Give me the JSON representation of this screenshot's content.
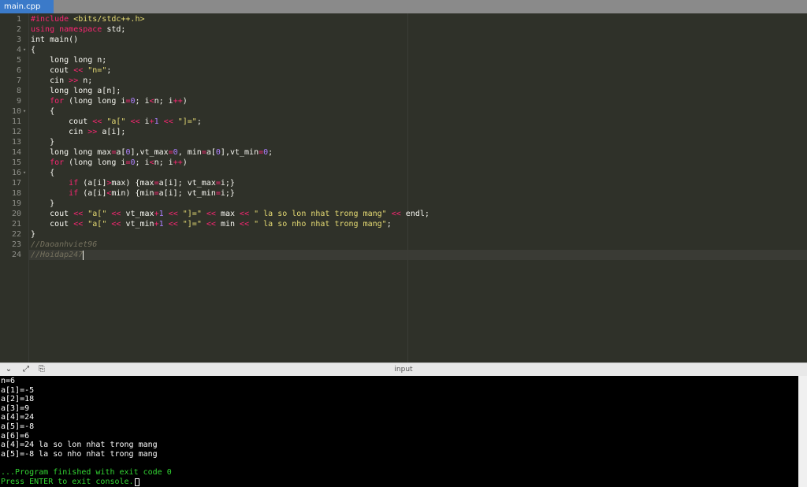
{
  "tab": {
    "label": "main.cpp"
  },
  "editor": {
    "line_numbers": [
      "1",
      "2",
      "3",
      "4",
      "5",
      "6",
      "7",
      "8",
      "9",
      "10",
      "11",
      "12",
      "13",
      "14",
      "15",
      "16",
      "17",
      "18",
      "19",
      "20",
      "21",
      "22",
      "23",
      "24"
    ],
    "fold_markers": {
      "4": "▾",
      "10": "▾",
      "16": "▾"
    },
    "lines": [
      [
        {
          "t": "pp",
          "v": "#include "
        },
        {
          "t": "inc",
          "v": "<bits/stdc++.h>"
        }
      ],
      [
        {
          "t": "kw",
          "v": "using"
        },
        {
          "t": "plain",
          "v": " "
        },
        {
          "t": "kw",
          "v": "namespace"
        },
        {
          "t": "plain",
          "v": " std;"
        }
      ],
      [
        {
          "t": "plain",
          "v": "int main()"
        }
      ],
      [
        {
          "t": "plain",
          "v": "{"
        }
      ],
      [
        {
          "t": "plain",
          "v": "    long long n;"
        }
      ],
      [
        {
          "t": "plain",
          "v": "    cout "
        },
        {
          "t": "kw",
          "v": "<<"
        },
        {
          "t": "plain",
          "v": " "
        },
        {
          "t": "str",
          "v": "\"n=\""
        },
        {
          "t": "plain",
          "v": ";"
        }
      ],
      [
        {
          "t": "plain",
          "v": "    cin "
        },
        {
          "t": "kw",
          "v": ">>"
        },
        {
          "t": "plain",
          "v": " n;"
        }
      ],
      [
        {
          "t": "plain",
          "v": "    long long a[n];"
        }
      ],
      [
        {
          "t": "plain",
          "v": "    "
        },
        {
          "t": "kw",
          "v": "for"
        },
        {
          "t": "plain",
          "v": " (long long i"
        },
        {
          "t": "kw",
          "v": "="
        },
        {
          "t": "num",
          "v": "0"
        },
        {
          "t": "plain",
          "v": "; i"
        },
        {
          "t": "kw",
          "v": "<"
        },
        {
          "t": "plain",
          "v": "n; i"
        },
        {
          "t": "kw",
          "v": "++"
        },
        {
          "t": "plain",
          "v": ")"
        }
      ],
      [
        {
          "t": "plain",
          "v": "    {"
        }
      ],
      [
        {
          "t": "plain",
          "v": "        cout "
        },
        {
          "t": "kw",
          "v": "<<"
        },
        {
          "t": "plain",
          "v": " "
        },
        {
          "t": "str",
          "v": "\"a[\""
        },
        {
          "t": "plain",
          "v": " "
        },
        {
          "t": "kw",
          "v": "<<"
        },
        {
          "t": "plain",
          "v": " i"
        },
        {
          "t": "kw",
          "v": "+"
        },
        {
          "t": "num",
          "v": "1"
        },
        {
          "t": "plain",
          "v": " "
        },
        {
          "t": "kw",
          "v": "<<"
        },
        {
          "t": "plain",
          "v": " "
        },
        {
          "t": "str",
          "v": "\"]=\""
        },
        {
          "t": "plain",
          "v": ";"
        }
      ],
      [
        {
          "t": "plain",
          "v": "        cin "
        },
        {
          "t": "kw",
          "v": ">>"
        },
        {
          "t": "plain",
          "v": " a[i];"
        }
      ],
      [
        {
          "t": "plain",
          "v": "    }"
        }
      ],
      [
        {
          "t": "plain",
          "v": "    long long max"
        },
        {
          "t": "kw",
          "v": "="
        },
        {
          "t": "plain",
          "v": "a["
        },
        {
          "t": "num",
          "v": "0"
        },
        {
          "t": "plain",
          "v": "],vt_max"
        },
        {
          "t": "kw",
          "v": "="
        },
        {
          "t": "num",
          "v": "0"
        },
        {
          "t": "plain",
          "v": ", min"
        },
        {
          "t": "kw",
          "v": "="
        },
        {
          "t": "plain",
          "v": "a["
        },
        {
          "t": "num",
          "v": "0"
        },
        {
          "t": "plain",
          "v": "],vt_min"
        },
        {
          "t": "kw",
          "v": "="
        },
        {
          "t": "num",
          "v": "0"
        },
        {
          "t": "plain",
          "v": ";"
        }
      ],
      [
        {
          "t": "plain",
          "v": "    "
        },
        {
          "t": "kw",
          "v": "for"
        },
        {
          "t": "plain",
          "v": " (long long i"
        },
        {
          "t": "kw",
          "v": "="
        },
        {
          "t": "num",
          "v": "0"
        },
        {
          "t": "plain",
          "v": "; i"
        },
        {
          "t": "kw",
          "v": "<"
        },
        {
          "t": "plain",
          "v": "n; i"
        },
        {
          "t": "kw",
          "v": "++"
        },
        {
          "t": "plain",
          "v": ")"
        }
      ],
      [
        {
          "t": "plain",
          "v": "    {"
        }
      ],
      [
        {
          "t": "plain",
          "v": "        "
        },
        {
          "t": "kw",
          "v": "if"
        },
        {
          "t": "plain",
          "v": " (a[i]"
        },
        {
          "t": "kw",
          "v": ">"
        },
        {
          "t": "plain",
          "v": "max) {max"
        },
        {
          "t": "kw",
          "v": "="
        },
        {
          "t": "plain",
          "v": "a[i]; vt_max"
        },
        {
          "t": "kw",
          "v": "="
        },
        {
          "t": "plain",
          "v": "i;}"
        }
      ],
      [
        {
          "t": "plain",
          "v": "        "
        },
        {
          "t": "kw",
          "v": "if"
        },
        {
          "t": "plain",
          "v": " (a[i]"
        },
        {
          "t": "kw",
          "v": "<"
        },
        {
          "t": "plain",
          "v": "min) {min"
        },
        {
          "t": "kw",
          "v": "="
        },
        {
          "t": "plain",
          "v": "a[i]; vt_min"
        },
        {
          "t": "kw",
          "v": "="
        },
        {
          "t": "plain",
          "v": "i;}"
        }
      ],
      [
        {
          "t": "plain",
          "v": "    }"
        }
      ],
      [
        {
          "t": "plain",
          "v": "    cout "
        },
        {
          "t": "kw",
          "v": "<<"
        },
        {
          "t": "plain",
          "v": " "
        },
        {
          "t": "str",
          "v": "\"a[\""
        },
        {
          "t": "plain",
          "v": " "
        },
        {
          "t": "kw",
          "v": "<<"
        },
        {
          "t": "plain",
          "v": " vt_max"
        },
        {
          "t": "kw",
          "v": "+"
        },
        {
          "t": "num",
          "v": "1"
        },
        {
          "t": "plain",
          "v": " "
        },
        {
          "t": "kw",
          "v": "<<"
        },
        {
          "t": "plain",
          "v": " "
        },
        {
          "t": "str",
          "v": "\"]=\""
        },
        {
          "t": "plain",
          "v": " "
        },
        {
          "t": "kw",
          "v": "<<"
        },
        {
          "t": "plain",
          "v": " max "
        },
        {
          "t": "kw",
          "v": "<<"
        },
        {
          "t": "plain",
          "v": " "
        },
        {
          "t": "str",
          "v": "\" la so lon nhat trong mang\""
        },
        {
          "t": "plain",
          "v": " "
        },
        {
          "t": "kw",
          "v": "<<"
        },
        {
          "t": "plain",
          "v": " endl;"
        }
      ],
      [
        {
          "t": "plain",
          "v": "    cout "
        },
        {
          "t": "kw",
          "v": "<<"
        },
        {
          "t": "plain",
          "v": " "
        },
        {
          "t": "str",
          "v": "\"a[\""
        },
        {
          "t": "plain",
          "v": " "
        },
        {
          "t": "kw",
          "v": "<<"
        },
        {
          "t": "plain",
          "v": " vt_min"
        },
        {
          "t": "kw",
          "v": "+"
        },
        {
          "t": "num",
          "v": "1"
        },
        {
          "t": "plain",
          "v": " "
        },
        {
          "t": "kw",
          "v": "<<"
        },
        {
          "t": "plain",
          "v": " "
        },
        {
          "t": "str",
          "v": "\"]=\""
        },
        {
          "t": "plain",
          "v": " "
        },
        {
          "t": "kw",
          "v": "<<"
        },
        {
          "t": "plain",
          "v": " min "
        },
        {
          "t": "kw",
          "v": "<<"
        },
        {
          "t": "plain",
          "v": " "
        },
        {
          "t": "str",
          "v": "\" la so nho nhat trong mang\""
        },
        {
          "t": "plain",
          "v": ";"
        }
      ],
      [
        {
          "t": "plain",
          "v": "}"
        }
      ],
      [
        {
          "t": "cmt",
          "v": "//Daoanhviet96"
        }
      ],
      [
        {
          "t": "cmt",
          "v": "//Hoidap247"
        }
      ]
    ]
  },
  "panel": {
    "title": "input",
    "buttons": [
      {
        "name": "collapse-chevron-icon",
        "glyph": "⌄"
      },
      {
        "name": "expand-arrows-icon",
        "glyph": "⤢"
      },
      {
        "name": "copy-icon",
        "glyph": "⎘"
      }
    ]
  },
  "console": {
    "lines": [
      {
        "text": "n=6",
        "green": false
      },
      {
        "text": "a[1]=-5",
        "green": false
      },
      {
        "text": "a[2]=18",
        "green": false
      },
      {
        "text": "a[3]=9",
        "green": false
      },
      {
        "text": "a[4]=24",
        "green": false
      },
      {
        "text": "a[5]=-8",
        "green": false
      },
      {
        "text": "a[6]=6",
        "green": false
      },
      {
        "text": "a[4]=24 la so lon nhat trong mang",
        "green": false
      },
      {
        "text": "a[5]=-8 la so nho nhat trong mang",
        "green": false
      },
      {
        "text": "",
        "green": false
      },
      {
        "text": "...Program finished with exit code 0",
        "green": true
      },
      {
        "text": "Press ENTER to exit console.",
        "green": true
      }
    ]
  }
}
